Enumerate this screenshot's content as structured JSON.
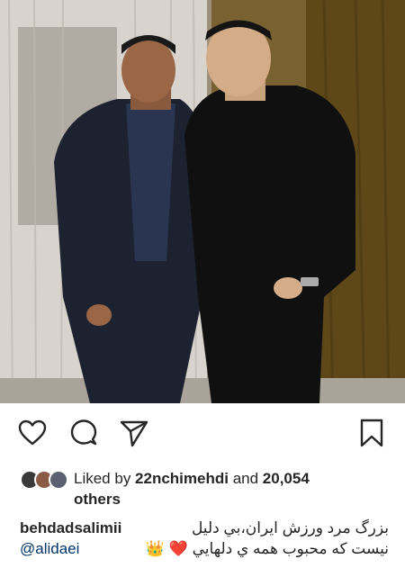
{
  "post": {
    "author": "behdadsalimii",
    "caption_line1": "بزرگ مرد ورزش ایران،بي دليل",
    "caption_line2": "نيست كه محبوب همه ي دلهايي",
    "mention": "@alidaei",
    "crown_emoji": "👑",
    "heart_emoji": "❤️"
  },
  "likes": {
    "prefix": "Liked by ",
    "user": "22nchimehdi",
    "connector": " and ",
    "count": "20,054",
    "suffix": "others"
  },
  "icons": {
    "like": "heart-icon",
    "comment": "comment-icon",
    "share": "send-icon",
    "save": "bookmark-icon"
  },
  "colors": {
    "text": "#262626",
    "mention": "#003569",
    "background": "#ffffff"
  }
}
